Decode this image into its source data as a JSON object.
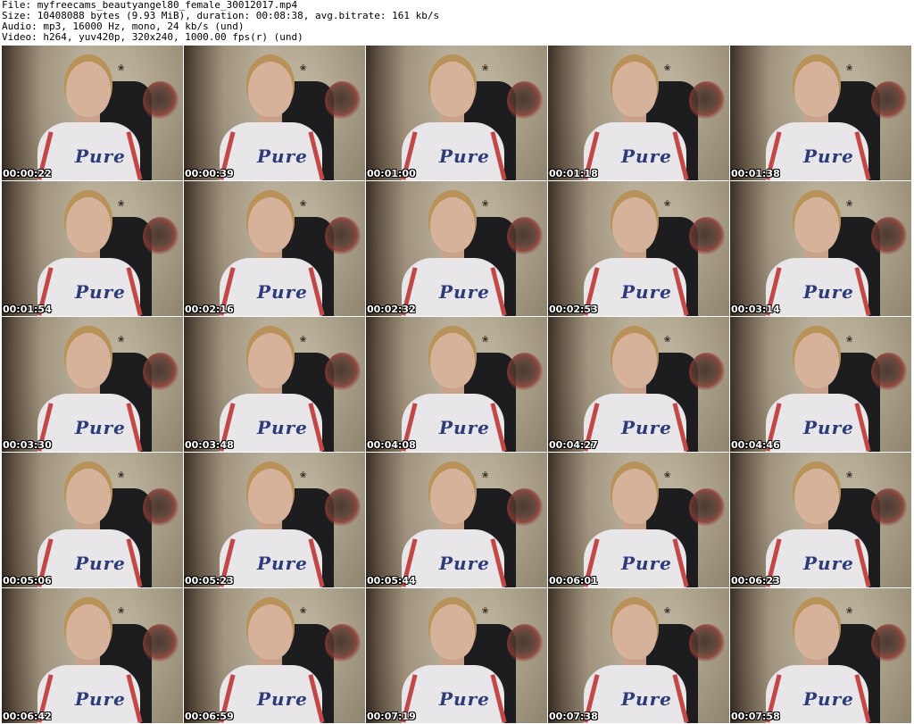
{
  "header": {
    "file": "File: myfreecams_beautyangel80_female_30012017.mp4",
    "size": "Size: 10408088 bytes (9.93 MiB), duration: 00:08:38, avg.bitrate: 161 kb/s",
    "audio": "Audio: mp3, 16000 Hz, mono, 24 kb/s (und)",
    "video": "Video: h264, yuv420p, 320x240, 1000.00 fps(r) (und)"
  },
  "thumbnails": [
    {
      "timestamp": "00:00:22"
    },
    {
      "timestamp": "00:00:39"
    },
    {
      "timestamp": "00:01:00"
    },
    {
      "timestamp": "00:01:18"
    },
    {
      "timestamp": "00:01:38"
    },
    {
      "timestamp": "00:01:54"
    },
    {
      "timestamp": "00:02:16"
    },
    {
      "timestamp": "00:02:32"
    },
    {
      "timestamp": "00:02:53"
    },
    {
      "timestamp": "00:03:14"
    },
    {
      "timestamp": "00:03:30"
    },
    {
      "timestamp": "00:03:48"
    },
    {
      "timestamp": "00:04:08"
    },
    {
      "timestamp": "00:04:27"
    },
    {
      "timestamp": "00:04:46"
    },
    {
      "timestamp": "00:05:06"
    },
    {
      "timestamp": "00:05:23"
    },
    {
      "timestamp": "00:05:44"
    },
    {
      "timestamp": "00:06:01"
    },
    {
      "timestamp": "00:06:23"
    },
    {
      "timestamp": "00:06:42"
    },
    {
      "timestamp": "00:06:59"
    },
    {
      "timestamp": "00:07:19"
    },
    {
      "timestamp": "00:07:38"
    },
    {
      "timestamp": "00:07:58"
    }
  ],
  "shirt_logo": "Pure",
  "colors": {
    "background": "#ffffff",
    "header_text": "#000000",
    "timestamp_text": "#ffffff",
    "timestamp_outline": "#000000"
  }
}
